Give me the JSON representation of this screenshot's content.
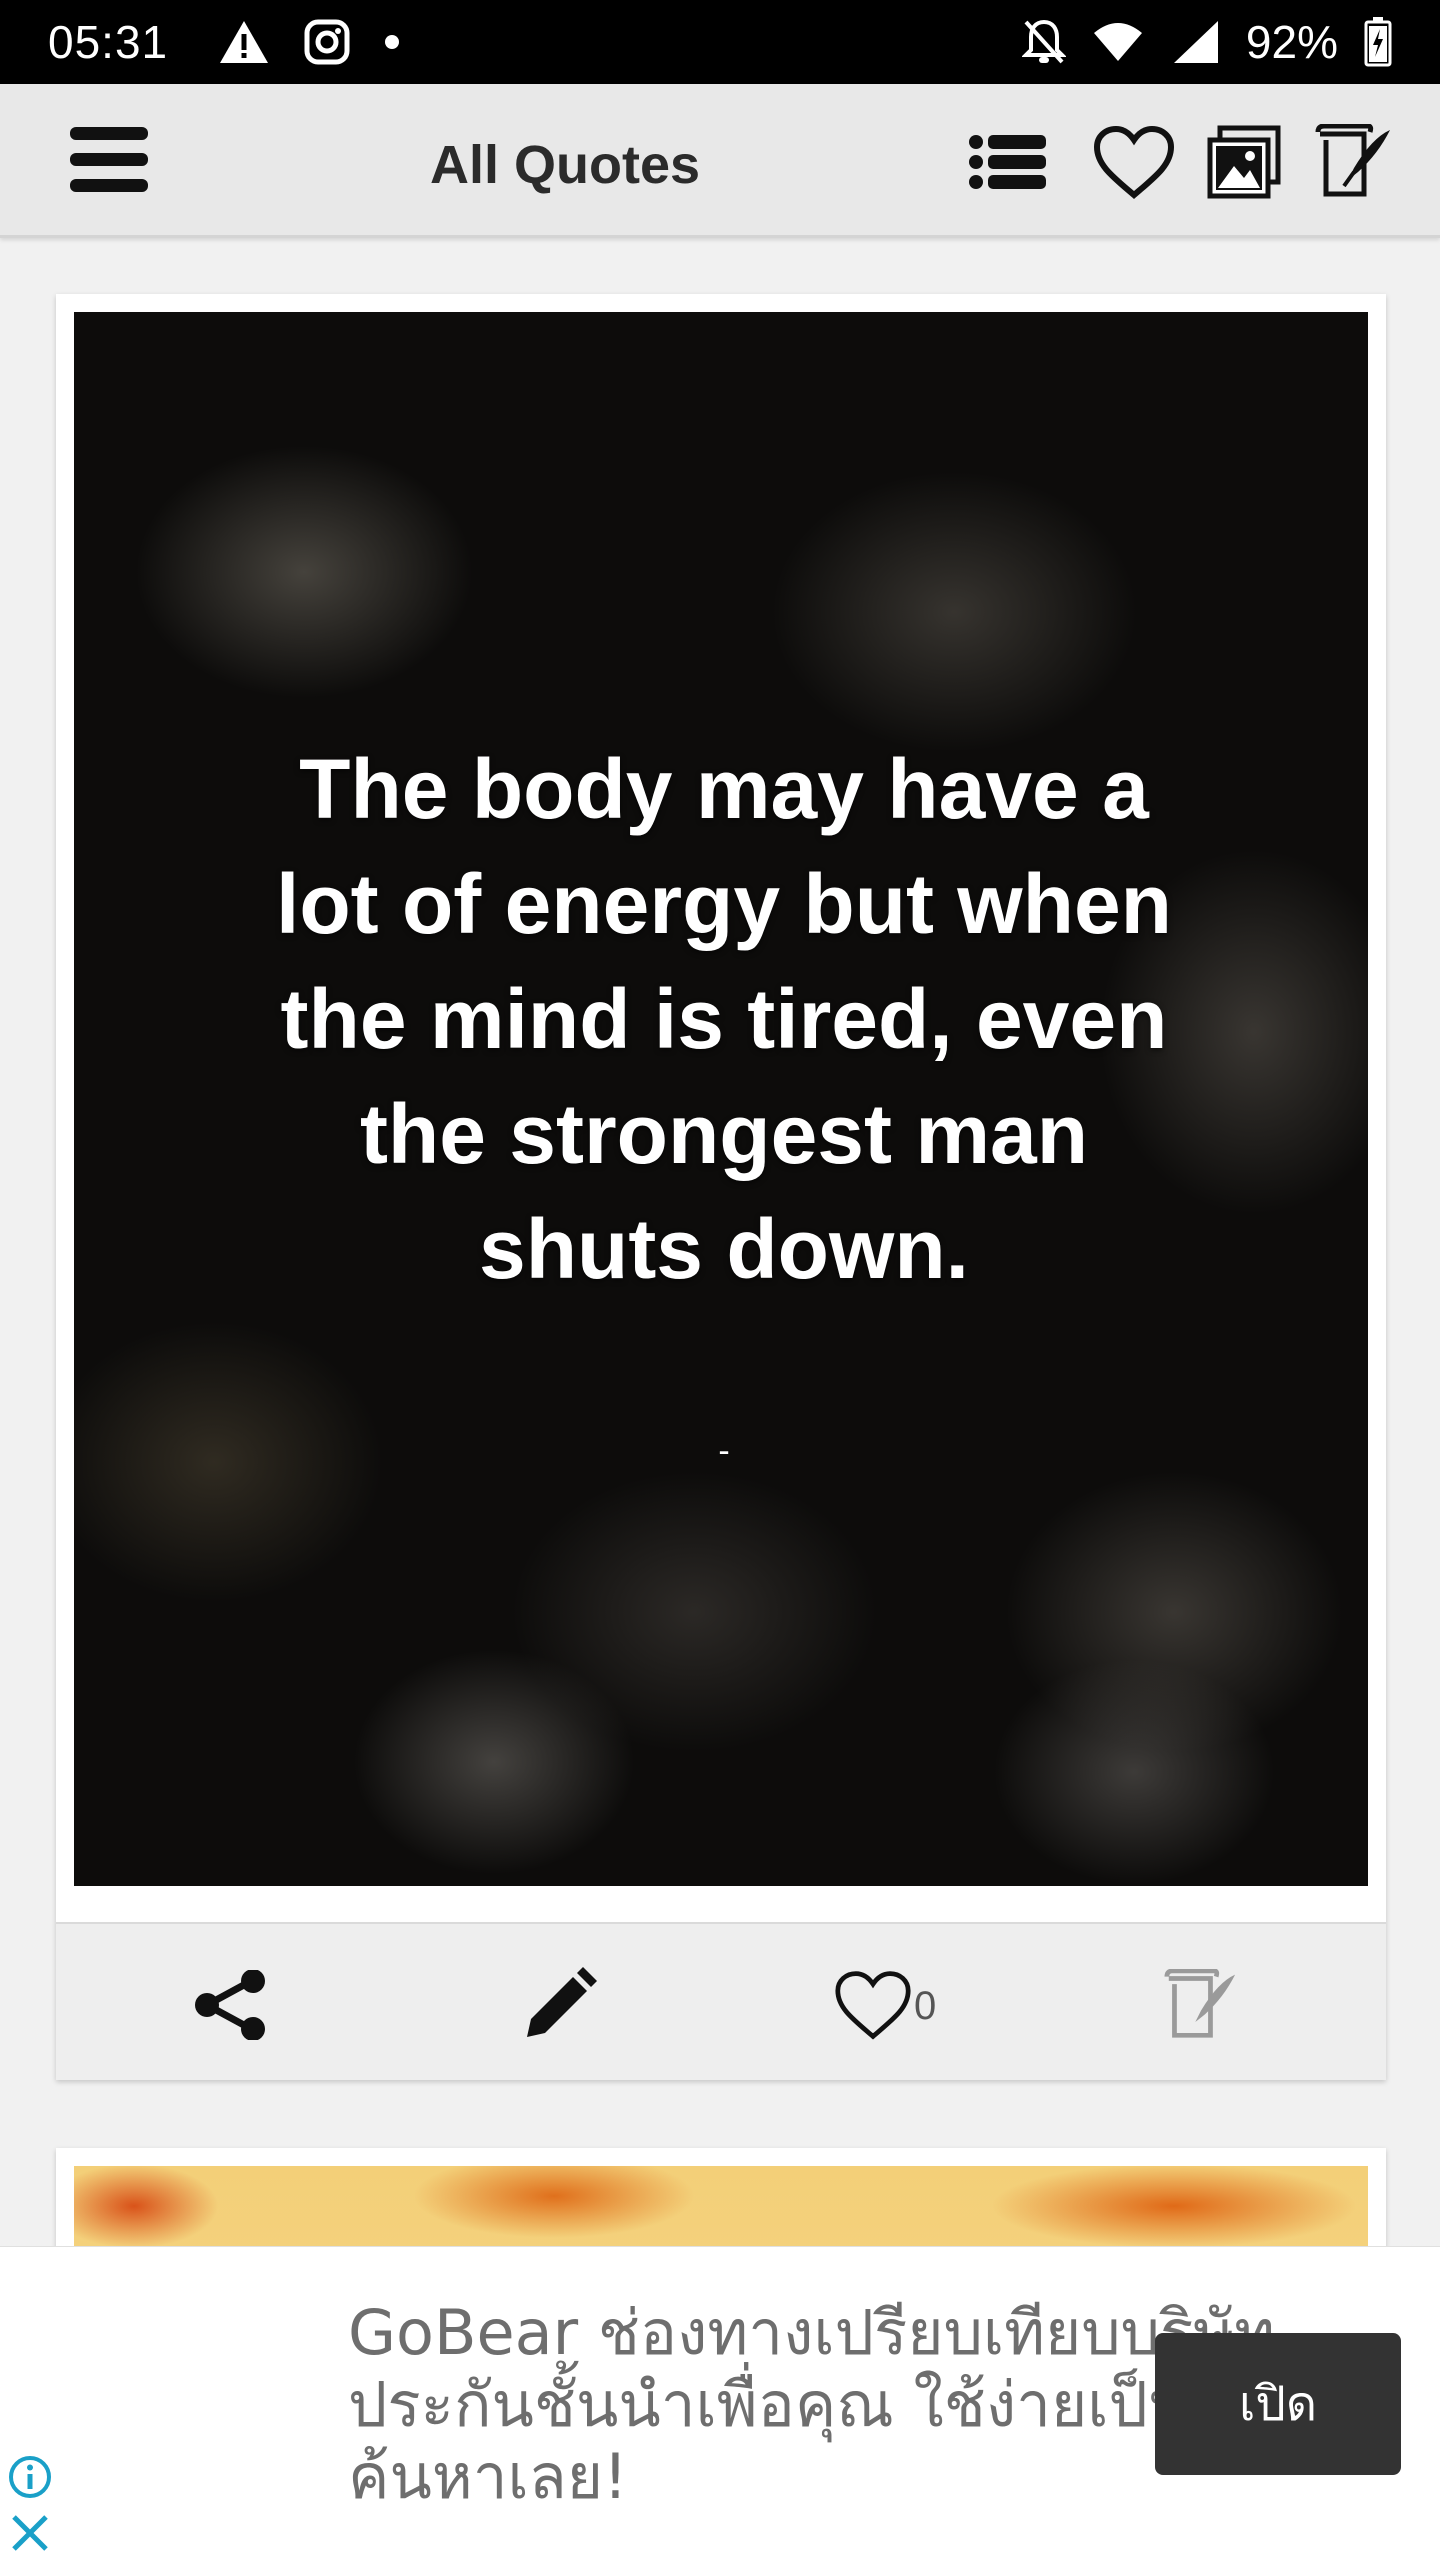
{
  "status_bar": {
    "time": "05:31",
    "battery": "92%",
    "icons": [
      "warning-icon",
      "instagram-icon",
      "dot-icon",
      "mute-icon",
      "wifi-icon",
      "signal-icon",
      "battery-icon"
    ]
  },
  "app_bar": {
    "title": "All Quotes",
    "icons": [
      "menu-icon",
      "list-icon",
      "heart-icon",
      "gallery-icon",
      "compose-icon"
    ]
  },
  "quote_card": {
    "quote": "The body may have a lot of energy but when the mind is tired, even the strongest man shuts down.",
    "author": "-",
    "like_count": "0",
    "actions": [
      "share-icon",
      "edit-icon",
      "heart-icon",
      "compose-icon"
    ]
  },
  "ad": {
    "text": "GoBear ช่องทางเปรียบเทียบบริษัทประกันชั้นนำเพื่อคุณ ใช้ง่ายเป็นกลาง ค้นหาเลย!",
    "cta": "เปิด"
  },
  "colors": {
    "status_bar_bg": "#000000",
    "app_bar_bg": "#e8e8e8",
    "page_bg": "#f1f1f1",
    "cta_bg": "#333333"
  }
}
